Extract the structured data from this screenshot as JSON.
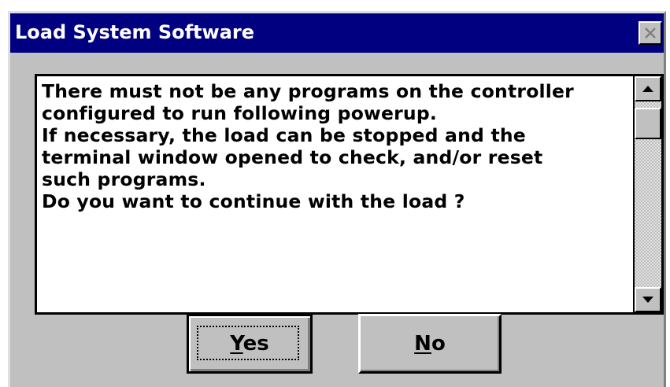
{
  "window": {
    "title": "Load System Software"
  },
  "message": {
    "lines": [
      "There must not be any programs on the controller",
      "configured to run following powerup.",
      "If necessary, the load can be stopped and the",
      "terminal window opened to check, and/or reset",
      "such programs.",
      "Do you want to continue with the load ?"
    ]
  },
  "buttons": {
    "yes": {
      "mnemonic": "Y",
      "rest": "es"
    },
    "no": {
      "mnemonic": "N",
      "rest": "o"
    }
  },
  "icons": {
    "close": "close-icon",
    "scroll_up": "arrow-up-icon",
    "scroll_down": "arrow-down-icon"
  },
  "colors": {
    "title_bar": "#000080",
    "dialog_face": "#c0c0c0",
    "title_text": "#ffffff"
  }
}
